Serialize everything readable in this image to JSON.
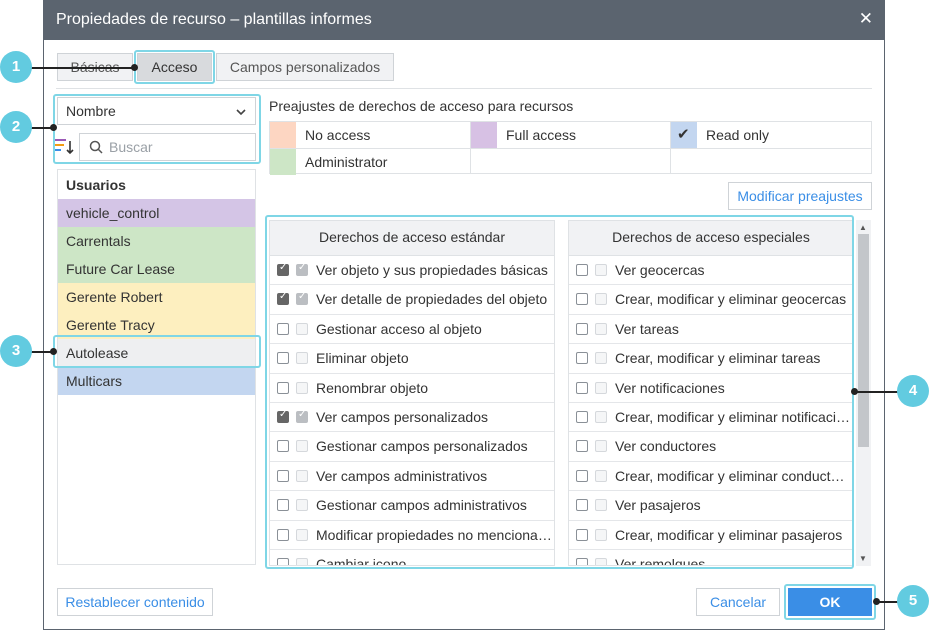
{
  "window": {
    "title": "Propiedades de recurso – plantillas informes"
  },
  "tabs": [
    {
      "label": "Básicas"
    },
    {
      "label": "Acceso"
    },
    {
      "label": "Campos personalizados"
    }
  ],
  "left_panel": {
    "sort_select_value": "Nombre",
    "search_placeholder": "Buscar",
    "list_header": "Usuarios",
    "users": [
      {
        "name": "vehicle_control",
        "color": "#d4c5e6"
      },
      {
        "name": "Carrentals",
        "color": "#cde6c6"
      },
      {
        "name": "Future Car Lease",
        "color": "#cde6c6"
      },
      {
        "name": "Gerente Robert",
        "color": "#fdefbf"
      },
      {
        "name": "Gerente Tracy",
        "color": "#fdefbf"
      },
      {
        "name": "Autolease",
        "color": "#eeeff1"
      },
      {
        "name": "Multicars",
        "color": "#c3d6f0"
      }
    ]
  },
  "presets": {
    "label": "Preajustes de derechos de acceso para recursos",
    "items": [
      {
        "label": "No access",
        "color": "#fdd6c2",
        "checked": false
      },
      {
        "label": "Full access",
        "color": "#d7c1e4",
        "checked": false
      },
      {
        "label": "Read only",
        "color": "#c3d6f0",
        "checked": true
      },
      {
        "label": "Administrator",
        "color": "#cde6c6",
        "checked": false
      }
    ],
    "modify_button": "Modificar preajustes"
  },
  "standard_rights": {
    "header": "Derechos de acceso estándar",
    "rows": [
      {
        "label": "Ver objeto y sus propiedades básicas",
        "checked": true
      },
      {
        "label": "Ver detalle de propiedades del objeto",
        "checked": true
      },
      {
        "label": "Gestionar acceso al objeto",
        "checked": false
      },
      {
        "label": "Eliminar objeto",
        "checked": false
      },
      {
        "label": "Renombrar objeto",
        "checked": false
      },
      {
        "label": "Ver campos personalizados",
        "checked": true
      },
      {
        "label": "Gestionar campos personalizados",
        "checked": false
      },
      {
        "label": "Ver campos administrativos",
        "checked": false
      },
      {
        "label": "Gestionar campos administrativos",
        "checked": false
      },
      {
        "label": "Modificar propiedades no mencionadas",
        "checked": false
      },
      {
        "label": "Cambiar icono",
        "checked": false
      }
    ]
  },
  "special_rights": {
    "header": "Derechos de acceso especiales",
    "rows": [
      {
        "label": "Ver geocercas",
        "checked": false
      },
      {
        "label": "Crear, modificar y eliminar geocercas",
        "checked": false
      },
      {
        "label": "Ver tareas",
        "checked": false
      },
      {
        "label": "Crear, modificar y eliminar tareas",
        "checked": false
      },
      {
        "label": "Ver notificaciones",
        "checked": false
      },
      {
        "label": "Crear, modificar y eliminar notificaciones",
        "checked": false
      },
      {
        "label": "Ver conductores",
        "checked": false
      },
      {
        "label": "Crear, modificar y eliminar conductores",
        "checked": false
      },
      {
        "label": "Ver pasajeros",
        "checked": false
      },
      {
        "label": "Crear, modificar y eliminar pasajeros",
        "checked": false
      },
      {
        "label": "Ver remolques",
        "checked": false
      }
    ]
  },
  "footer": {
    "reset_button": "Restablecer contenido",
    "cancel_button": "Cancelar",
    "ok_button": "OK"
  },
  "callouts": [
    "1",
    "2",
    "3",
    "4",
    "5"
  ],
  "colors": {
    "accent": "#3a8ee6",
    "highlight": "#7fd6e6",
    "badge": "#62cbe0",
    "titlebar": "#5b646f"
  }
}
